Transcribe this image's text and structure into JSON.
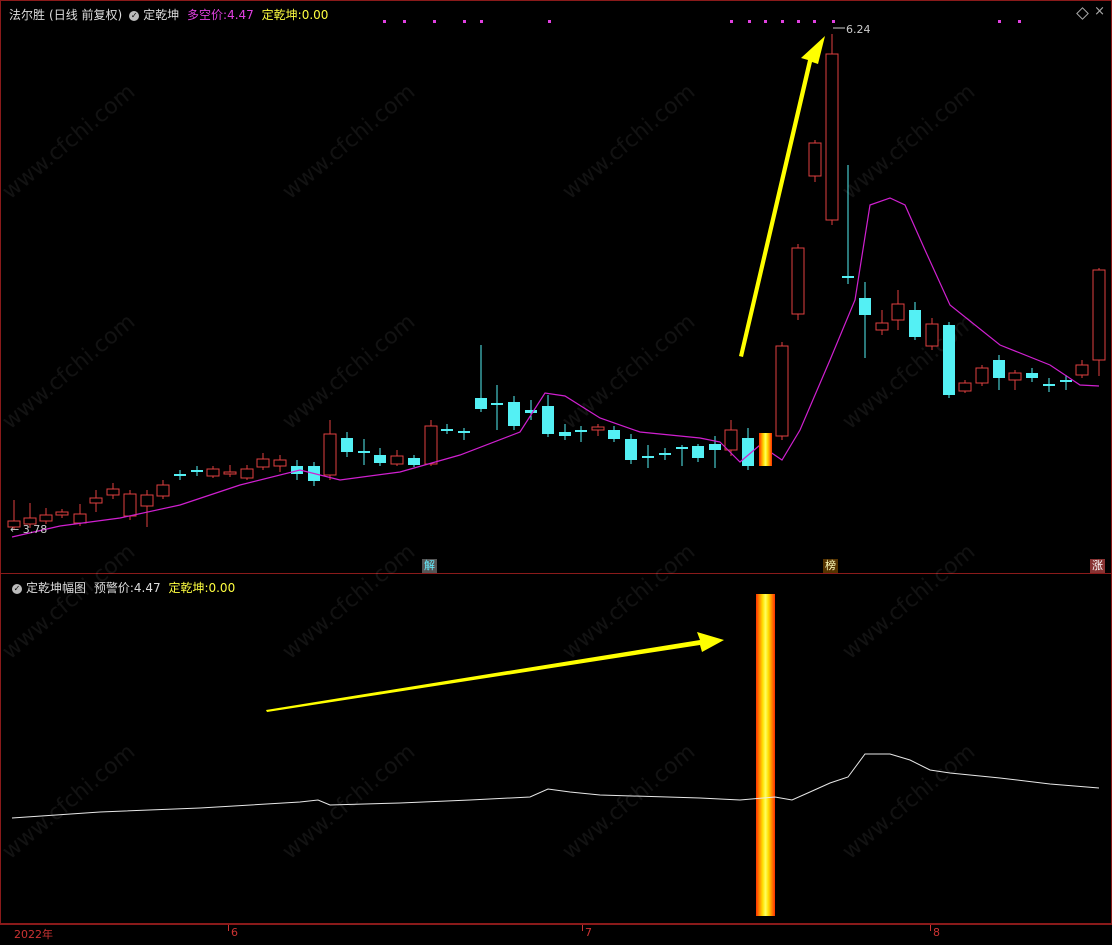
{
  "main": {
    "stock_name": "法尔胜",
    "period": "(日线 前复权)",
    "indicator": "定乾坤",
    "duokong_label": "多空价:",
    "duokong_value": "4.47",
    "dqk_label": "定乾坤:",
    "dqk_value": "0.00",
    "high_label": "6.24",
    "low_label": "3.78",
    "tag_jie": "解",
    "tag_bang": "榜",
    "tag_zhang": "涨"
  },
  "sub": {
    "indicator": "定乾坤幅图",
    "warn_label": "预警价:",
    "warn_value": "4.47",
    "dqk_label": "定乾坤:",
    "dqk_value": "0.00"
  },
  "axis": {
    "year": "2022年",
    "m6": "6",
    "m7": "7",
    "m8": "8"
  },
  "watermark": "www.cfchi.com",
  "colors": {
    "up": "#e04040",
    "down": "#54f0f4",
    "ma": "#d020d0",
    "arrow": "#ffff00",
    "highlight": "#ffa000"
  }
}
